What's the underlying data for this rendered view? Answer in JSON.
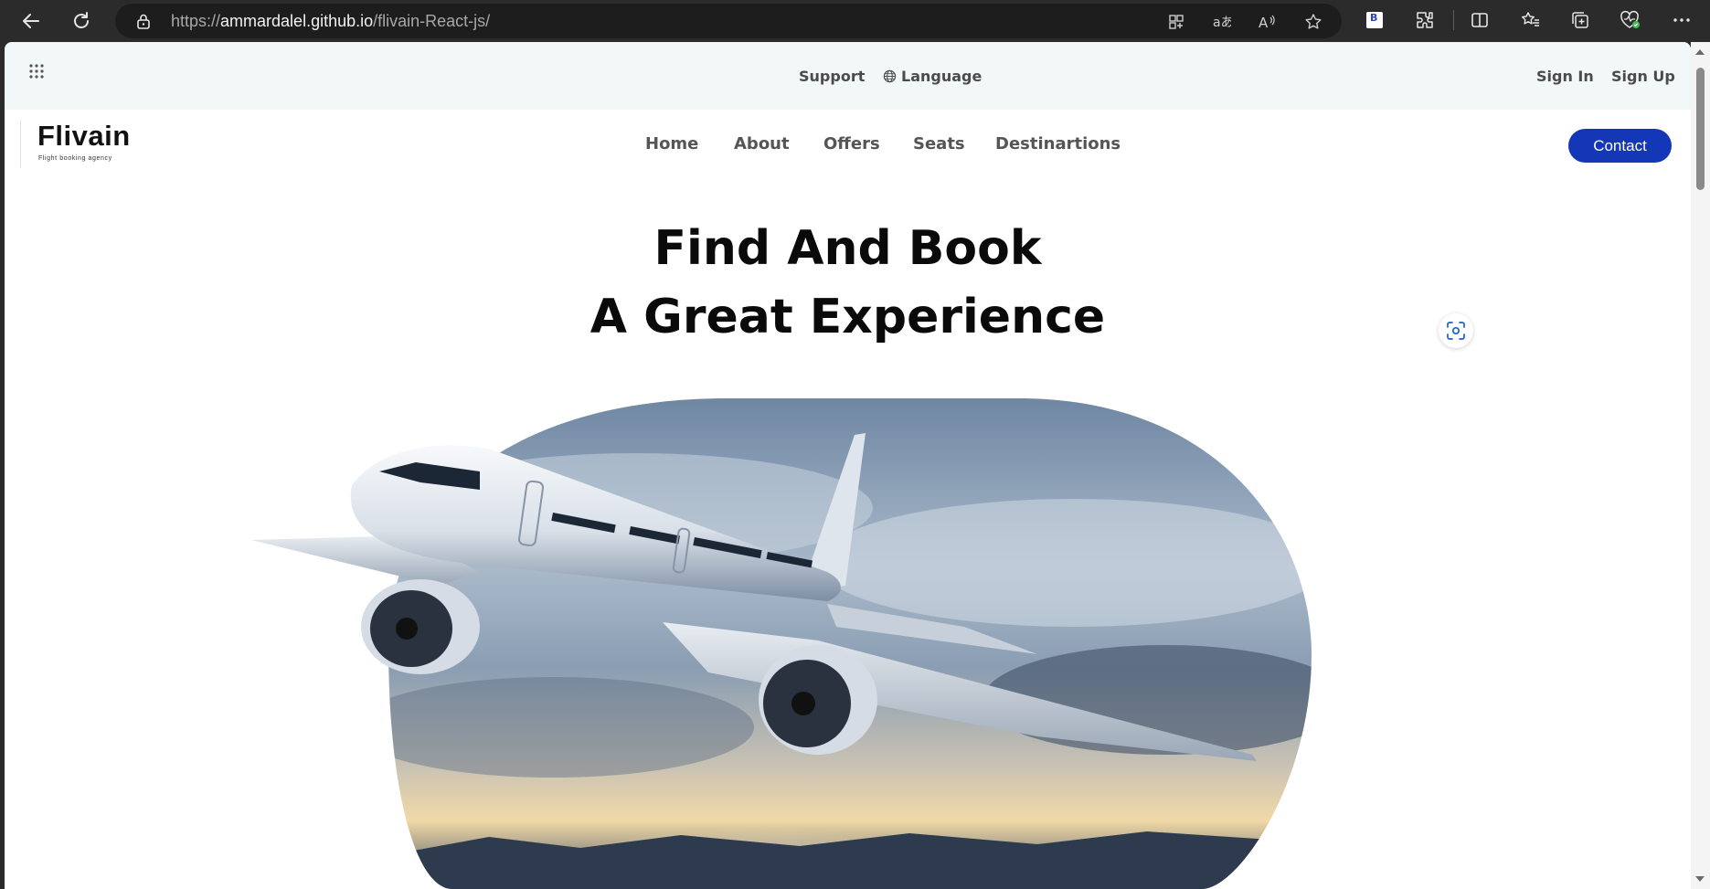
{
  "browser": {
    "url_scheme": "https://",
    "url_host": "ammardalel.github.io",
    "url_path": "/flivain-React-js/",
    "extension_label": "B"
  },
  "topbar": {
    "support": "Support",
    "language": "Language",
    "sign_in": "Sign In",
    "sign_up": "Sign Up"
  },
  "logo": {
    "name": "Flivain",
    "tagline": "Flight booking agency"
  },
  "nav": {
    "items": [
      "Home",
      "About",
      "Offers",
      "Seats",
      "Destinartions"
    ],
    "contact": "Contact"
  },
  "hero": {
    "line1": "Find And Book",
    "line2": "A Great Experience"
  },
  "colors": {
    "accent": "#1437b8",
    "topbar_bg": "#f2f7f7",
    "chrome_bg": "#2b2b2b"
  },
  "icons": {
    "back": "back-arrow-icon",
    "refresh": "refresh-icon",
    "lock": "lock-icon",
    "apps": "app-grid-icon",
    "globe": "globe-icon",
    "visual_search": "visual-search-icon"
  }
}
